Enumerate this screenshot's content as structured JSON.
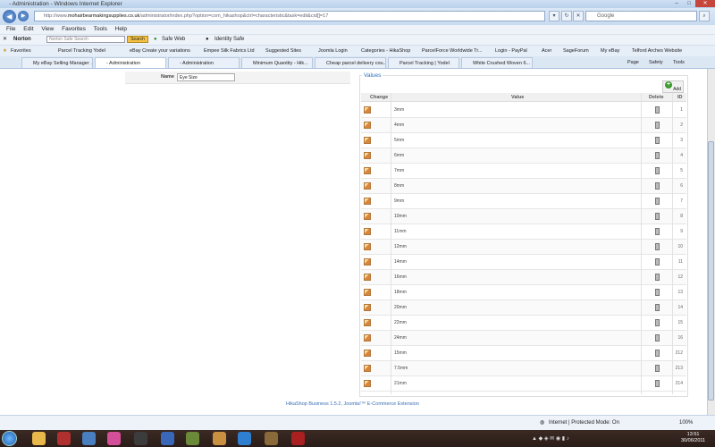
{
  "window": {
    "title": "- Administration - Windows Internet Explorer"
  },
  "address": {
    "url_prefix": "http://www.",
    "domain": "mohairbearmakingsupplies.co.uk",
    "url_rest": "/administrator/index.php?option=com_hikashop&ctrl=characteristic&task=edit&cid[]=17",
    "search_placeholder": "Google"
  },
  "menu": [
    "File",
    "Edit",
    "View",
    "Favorites",
    "Tools",
    "Help"
  ],
  "norton": {
    "brand": "Norton",
    "search_placeholder": "Norton Safe Search",
    "search_btn": "Search",
    "safe_web": "Safe Web",
    "identity_safe": "Identity Safe"
  },
  "favorites": {
    "label": "Favorites",
    "items": [
      "Parcel Tracking Yodel",
      "eBay Create your variations",
      "Empee Silk Fabrics Ltd",
      "Suggested Sites",
      "Joomla Login",
      "Categories - HikaShop",
      "ParcelForce Worldwide Tr...",
      "Login - PayPal",
      "Acer",
      "SageForum",
      "My eBay",
      "Telford Arches Website"
    ]
  },
  "tabs": [
    "My eBay Selling Manager ...",
    "- Administration",
    "- Administration",
    "Minimum Quantity - Hik...",
    "Cheap parcel delivery cou...",
    "Parcel Tracking | Yodel",
    "White Crushed Woven 6..."
  ],
  "tools": {
    "page": "Page",
    "safety": "Safety",
    "tools": "Tools"
  },
  "form": {
    "name_label": "Name",
    "name_value": "Eye Size"
  },
  "values": {
    "legend": "Values",
    "add_label": "Add",
    "col_change": "Change",
    "col_value": "Value",
    "col_delete": "Delete",
    "col_id": "ID",
    "rows": [
      {
        "value": "3mm",
        "id": "1"
      },
      {
        "value": "4mm",
        "id": "2"
      },
      {
        "value": "5mm",
        "id": "3"
      },
      {
        "value": "6mm",
        "id": "4"
      },
      {
        "value": "7mm",
        "id": "5"
      },
      {
        "value": "8mm",
        "id": "6"
      },
      {
        "value": "9mm",
        "id": "7"
      },
      {
        "value": "10mm",
        "id": "8"
      },
      {
        "value": "11mm",
        "id": "9"
      },
      {
        "value": "12mm",
        "id": "10"
      },
      {
        "value": "14mm",
        "id": "11"
      },
      {
        "value": "16mm",
        "id": "12"
      },
      {
        "value": "18mm",
        "id": "13"
      },
      {
        "value": "20mm",
        "id": "14"
      },
      {
        "value": "22mm",
        "id": "15"
      },
      {
        "value": "24mm",
        "id": "16"
      },
      {
        "value": "15mm",
        "id": "212"
      },
      {
        "value": "7.5mm",
        "id": "213"
      },
      {
        "value": "21mm",
        "id": "214"
      }
    ]
  },
  "footer": "HikaShop Business 1.5.2, Joomla!™ E-Commerce Extension",
  "status": {
    "zone": "Internet | Protected Mode: On",
    "zoom": "100%"
  },
  "clock": {
    "time": "13:51",
    "date": "30/06/2011"
  }
}
